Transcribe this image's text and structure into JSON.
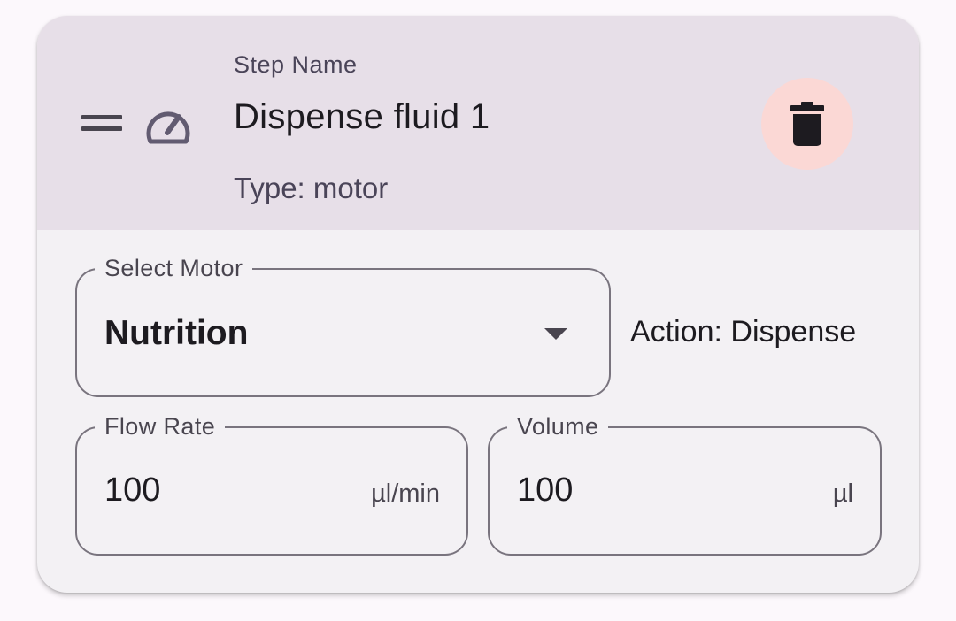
{
  "step": {
    "label": "Step Name",
    "name": "Dispense fluid 1",
    "type_text": "Type: motor"
  },
  "icons": {
    "drag": "drag-handle-icon",
    "type": "speedometer-icon",
    "delete": "trash-icon"
  },
  "motor": {
    "label": "Select Motor",
    "selected": "Nutrition"
  },
  "action_text": "Action: Dispense",
  "flow_rate": {
    "label": "Flow Rate",
    "value": "100",
    "unit": "µl/min"
  },
  "volume": {
    "label": "Volume",
    "value": "100",
    "unit": "µl"
  },
  "colors": {
    "header_bg": "#e7dfe8",
    "card_bg": "#f3f1f4",
    "delete_bg": "#fbd8d5",
    "outline": "#79747e",
    "text_primary": "#1d1b20",
    "text_secondary": "#49454f"
  }
}
